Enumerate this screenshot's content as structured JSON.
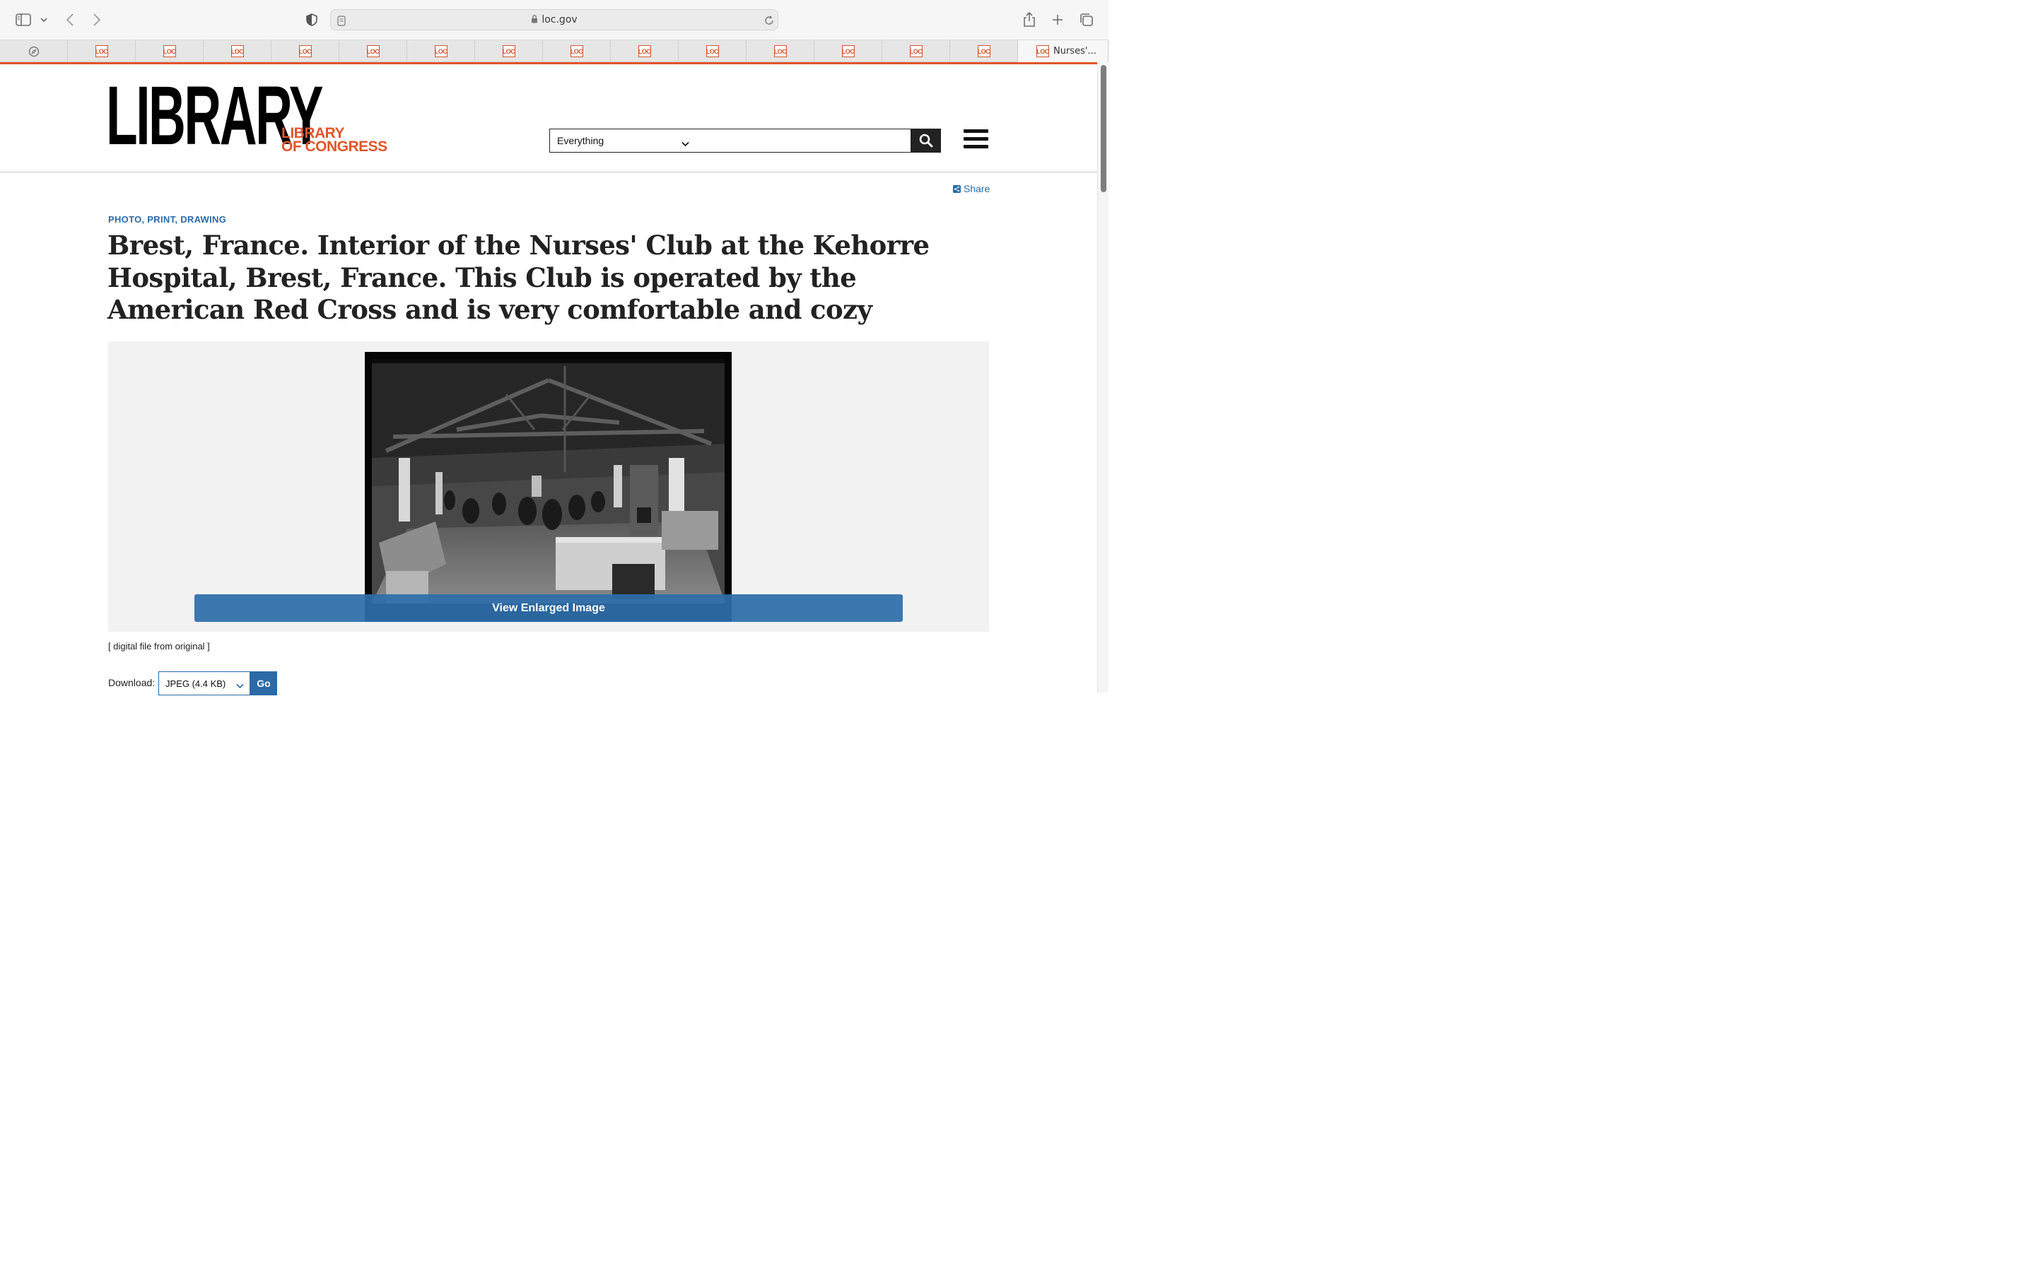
{
  "browser": {
    "url": "loc.gov",
    "active_tab_title": "Nurses'...",
    "tab_favicon_text": "LOC",
    "background_tab_count": 14
  },
  "header": {
    "logo_main": "LIBRARY",
    "logo_sub_line1": "LIBRARY",
    "logo_sub_line2": "OF CONGRESS",
    "search_scope": "Everything",
    "search_value": ""
  },
  "item": {
    "share_label": "Share",
    "format": "PHOTO, PRINT, DRAWING",
    "title": "Brest, France. Interior of the Nurses' Club at the Kehorre Hospital, Brest, France. This Club is operated by the American Red Cross and is very comfortable and cozy",
    "view_button": "View Enlarged Image",
    "caption": "[ digital file from original ]",
    "download_label": "Download:",
    "download_option": "JPEG (4.4 KB)",
    "go_label": "Go"
  },
  "colors": {
    "brand_orange": "#e0562a",
    "link_blue": "#2b6aa6"
  }
}
